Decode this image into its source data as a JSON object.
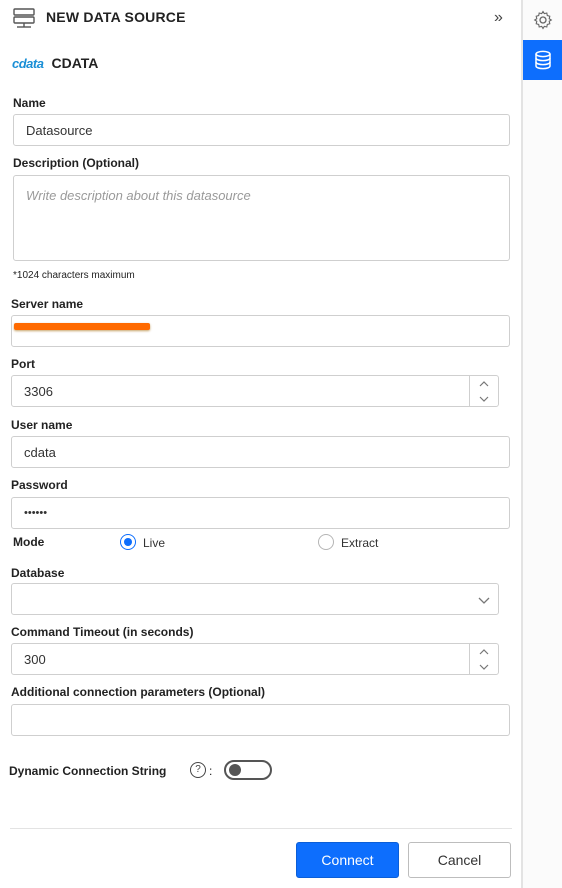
{
  "header": {
    "title": "NEW DATA SOURCE",
    "collapse_glyph": "»",
    "icon": "data-source-icon"
  },
  "brand": {
    "logo": "cdata",
    "name": "CDATA"
  },
  "form": {
    "name": {
      "label": "Name",
      "value": "Datasource"
    },
    "description": {
      "label": "Description (Optional)",
      "placeholder": "Write description about this datasource",
      "hint": "*1024 characters maximum"
    },
    "server": {
      "label": "Server name",
      "value": ""
    },
    "port": {
      "label": "Port",
      "value": "3306"
    },
    "user": {
      "label": "User name",
      "value": "cdata"
    },
    "password": {
      "label": "Password",
      "value": "••••••"
    },
    "mode": {
      "label": "Mode",
      "options": [
        "Live",
        "Extract"
      ],
      "selected": "Live"
    },
    "database": {
      "label": "Database",
      "value": ""
    },
    "timeout": {
      "label": "Command Timeout (in seconds)",
      "value": "300"
    },
    "additional": {
      "label": "Additional connection parameters (Optional)",
      "value": ""
    },
    "dynamic": {
      "label": "Dynamic Connection String",
      "colon": ":",
      "help": "?",
      "enabled": false
    }
  },
  "buttons": {
    "connect": "Connect",
    "cancel": "Cancel"
  },
  "rail": {
    "items": [
      "settings-icon",
      "database-icon"
    ],
    "active": "database-icon"
  },
  "colors": {
    "accent": "#0d6efd",
    "redaction": "#ff6a00",
    "logo": "#1a8fd6"
  }
}
